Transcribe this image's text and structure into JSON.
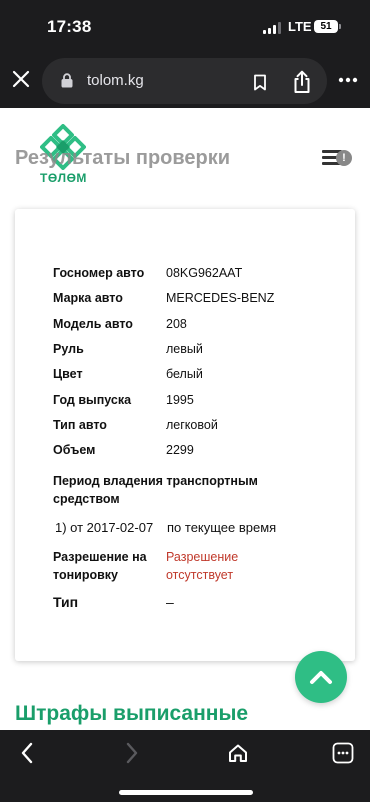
{
  "status_bar": {
    "time": "17:38",
    "network": "LTE",
    "battery": "51"
  },
  "browser": {
    "url": "tolom.kg"
  },
  "site": {
    "logo_text": "ТӨЛӨМ",
    "page_title": "Результаты проверки",
    "menu_badge": "!"
  },
  "details": [
    {
      "label": "Госномер авто",
      "value": "08KG962AAT"
    },
    {
      "label": "Марка авто",
      "value": "MERCEDES-BENZ"
    },
    {
      "label": "Модель авто",
      "value": "208"
    },
    {
      "label": "Руль",
      "value": "левый"
    },
    {
      "label": "Цвет",
      "value": "белый"
    },
    {
      "label": "Год выпуска",
      "value": "1995"
    },
    {
      "label": "Тип авто",
      "value": "легковой"
    },
    {
      "label": "Объем",
      "value": "2299"
    }
  ],
  "ownership": {
    "title": "Период владения транспортным средством",
    "period_from": "1) от 2017-02-07",
    "period_to": "по текущее время"
  },
  "tint": {
    "label": "Разрешение на тонировку",
    "value": "Разрешение отсутствует"
  },
  "type_row": {
    "label": "Тип",
    "value": "–"
  },
  "fines_title": "Штрафы выписанные",
  "colors": {
    "brand_green": "#1a9e6a",
    "scroll_button": "#2fbe85",
    "warning_red": "#c0392b"
  },
  "icons": {
    "close": "close-icon",
    "lock": "lock-icon",
    "bookmark": "bookmark-icon",
    "share": "share-icon",
    "more": "more-icon",
    "menu": "hamburger-icon",
    "scroll_top": "chevron-up-icon",
    "back": "chevron-left-icon",
    "forward": "chevron-right-icon",
    "home": "home-icon",
    "tabs": "tabs-icon"
  }
}
